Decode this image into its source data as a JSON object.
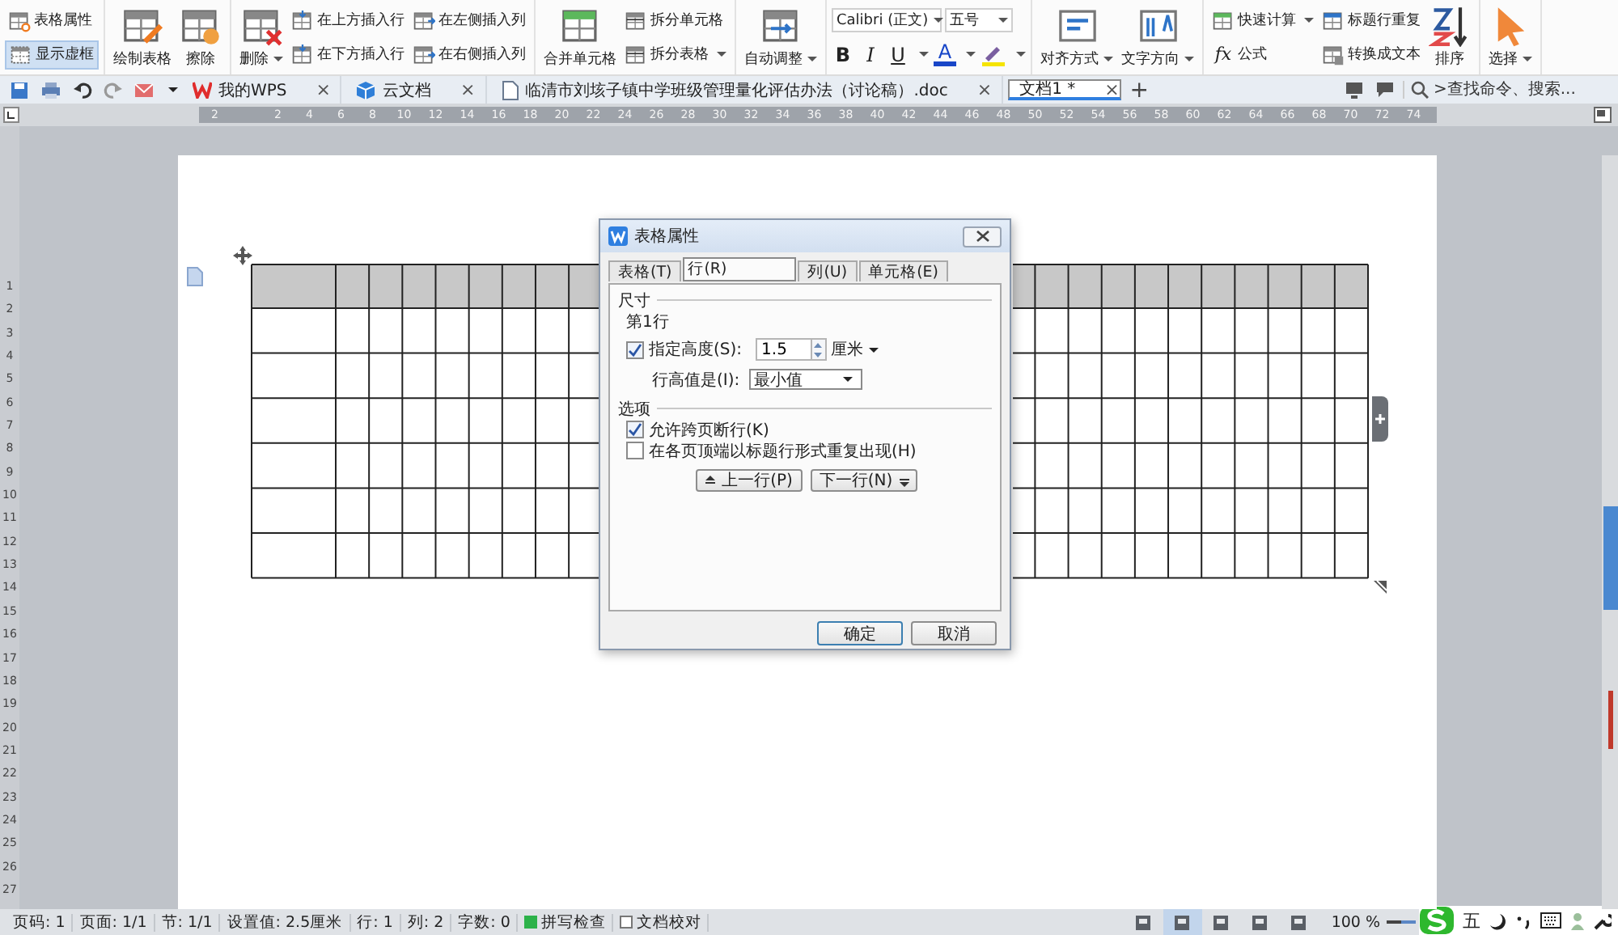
{
  "ribbon": {
    "groups": [
      {
        "items": [
          {
            "kind": "stack",
            "rows": [
              {
                "label": "表格属性",
                "selected": false
              },
              {
                "label": "显示虚框",
                "selected": true
              }
            ]
          }
        ]
      },
      {
        "items": [
          {
            "kind": "large",
            "label": "绘制表格"
          },
          {
            "kind": "large",
            "label": "擦除"
          }
        ]
      },
      {
        "items": [
          {
            "kind": "large",
            "label": "删除",
            "dropdown": true
          },
          {
            "kind": "stack",
            "rows": [
              {
                "label": "在上方插入行",
                "selected": false
              },
              {
                "label": "在下方插入行",
                "selected": false
              }
            ]
          },
          {
            "kind": "stack",
            "rows": [
              {
                "label": "在左侧插入列",
                "selected": false
              },
              {
                "label": "在右侧插入列",
                "selected": false
              }
            ]
          }
        ]
      },
      {
        "items": [
          {
            "kind": "large",
            "label": "合并单元格"
          },
          {
            "kind": "stack",
            "rows": [
              {
                "label": "拆分单元格",
                "selected": false
              },
              {
                "label": "拆分表格",
                "selected": false,
                "dropdown": true
              }
            ]
          }
        ]
      },
      {
        "items": [
          {
            "kind": "large",
            "label": "自动调整",
            "dropdown": true
          }
        ]
      },
      {
        "items": [
          {
            "kind": "font",
            "font": "Calibri (正文)",
            "size": "五号",
            "bold": "B",
            "italic": "I",
            "underline": "U",
            "color_letter": "A"
          }
        ]
      },
      {
        "items": [
          {
            "kind": "large",
            "label": "对齐方式",
            "dropdown": true
          },
          {
            "kind": "large",
            "label": "文字方向",
            "dropdown": true
          }
        ]
      },
      {
        "items": [
          {
            "kind": "stack",
            "rows": [
              {
                "label": "快速计算",
                "selected": false,
                "dropdown": true
              },
              {
                "label": "公式",
                "selected": false,
                "glyph": "fx"
              }
            ]
          },
          {
            "kind": "stack",
            "rows": [
              {
                "label": "标题行重复",
                "selected": false
              },
              {
                "label": "转换成文本",
                "selected": false
              }
            ]
          },
          {
            "kind": "large",
            "label": "排序"
          }
        ]
      },
      {
        "items": [
          {
            "kind": "large",
            "label": "选择",
            "dropdown": true
          }
        ]
      }
    ]
  },
  "tabbar": {
    "tabs": [
      {
        "label": "我的WPS",
        "close": "×",
        "selected": false
      },
      {
        "label": "云文档",
        "close": "×",
        "selected": false
      },
      {
        "label": "临清市刘垓子镇中学班级管理量化评估办法（讨论稿）.doc",
        "close": "×",
        "selected": false
      },
      {
        "label": "文档1 *",
        "close": "×",
        "selected": true
      }
    ],
    "new_tab": "+",
    "search": {
      "placeholder": ">查找命令、搜索..."
    }
  },
  "ruler": {
    "labels": [
      "2",
      "2",
      "4",
      "6",
      "8",
      "10",
      "12",
      "14",
      "16",
      "18",
      "20",
      "22",
      "24",
      "26",
      "28",
      "30",
      "32",
      "34",
      "36",
      "38",
      "40",
      "42",
      "44",
      "46",
      "48",
      "50",
      "52",
      "54",
      "56",
      "58",
      "60",
      "62",
      "64",
      "66",
      "68",
      "70",
      "72",
      "74"
    ]
  },
  "vertical_ruler": {
    "labels": [
      "1",
      "2",
      "3",
      "4",
      "5",
      "6",
      "7",
      "8",
      "9",
      "10",
      "11",
      "12",
      "13",
      "14",
      "15",
      "16",
      "17",
      "18",
      "19",
      "20",
      "21",
      "22",
      "23",
      "24",
      "25",
      "26",
      "27"
    ]
  },
  "dialog": {
    "title": "表格属性",
    "tabs": [
      {
        "label": "表格(T)",
        "selected": false
      },
      {
        "label": "行(R)",
        "selected": true
      },
      {
        "label": "列(U)",
        "selected": false
      },
      {
        "label": "单元格(E)",
        "selected": false
      }
    ],
    "size_section": "尺寸",
    "row_label": "第1行",
    "height": {
      "label": "指定高度(S):",
      "checked": true,
      "value": "1.5",
      "unit": "厘米"
    },
    "height_mode": {
      "label": "行高值是(I):",
      "value": "最小值"
    },
    "options_section": "选项",
    "options": [
      {
        "label": "允许跨页断行(K)",
        "checked": true
      },
      {
        "label": "在各页顶端以标题行形式重复出现(H)",
        "checked": false
      }
    ],
    "nav": [
      "上一行(P)",
      "下一行(N)"
    ],
    "buttons": [
      "确定",
      "取消"
    ]
  },
  "status_bar": {
    "items": [
      {
        "kind": "text",
        "label": "页码: 1"
      },
      {
        "kind": "text",
        "label": "页面: 1/1"
      },
      {
        "kind": "text",
        "label": "节: 1/1"
      },
      {
        "kind": "text",
        "label": "设置值: 2.5厘米"
      },
      {
        "kind": "text",
        "label": "行: 1"
      },
      {
        "kind": "text",
        "label": "列: 2"
      },
      {
        "kind": "text",
        "label": "字数: 0"
      },
      {
        "kind": "toggle",
        "label": "拼写检查",
        "on": true
      },
      {
        "kind": "toggle",
        "label": "文档校对",
        "on": false
      }
    ],
    "views": [
      {
        "selected": false
      },
      {
        "selected": true
      },
      {
        "selected": false
      },
      {
        "selected": false
      },
      {
        "selected": false
      }
    ],
    "zoom": "100 %",
    "zoom_slider": {
      "level": 0.5
    },
    "ime": {
      "mode": "五"
    }
  }
}
